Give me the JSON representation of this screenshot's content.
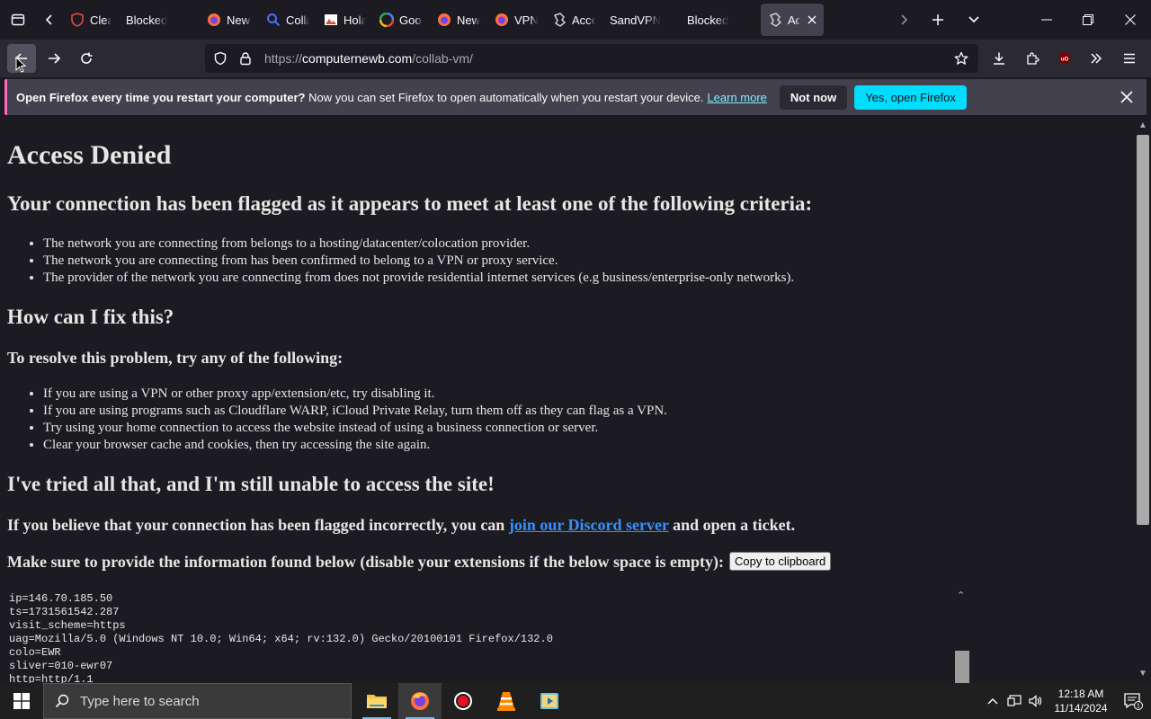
{
  "browser": {
    "tabs": [
      {
        "title": "Clear",
        "favicon": "shield-icon",
        "color": "#e34a4a"
      },
      {
        "title": "Blocked",
        "favicon": "",
        "color": ""
      },
      {
        "title": "New T",
        "favicon": "firefox-icon",
        "color": "#ff7139"
      },
      {
        "title": "Colla",
        "favicon": "search-icon",
        "color": "#4a6cff"
      },
      {
        "title": "Hola",
        "favicon": "image-icon",
        "color": "#e04d3a"
      },
      {
        "title": "Goog",
        "favicon": "google-icon",
        "color": "#4285f4"
      },
      {
        "title": "New T",
        "favicon": "firefox-icon",
        "color": "#ff7139"
      },
      {
        "title": "VPN -",
        "favicon": "firefox-icon",
        "color": "#ff7139"
      },
      {
        "title": "Acce",
        "favicon": "stamp-icon",
        "color": "#d0d0d0"
      },
      {
        "title": "SandVPN",
        "favicon": "",
        "color": ""
      },
      {
        "title": "Blocked",
        "favicon": "",
        "color": ""
      },
      {
        "title": "Ac",
        "favicon": "stamp-icon",
        "color": "#d0d0d0",
        "active": true
      }
    ],
    "url": {
      "scheme": "https://",
      "host": "computernewb.com",
      "path": "/collab-vm/"
    },
    "notification": {
      "bold": "Open Firefox every time you restart your computer?",
      "text": "Now you can set Firefox to open automatically when you restart your device.",
      "link": "Learn more",
      "not_now": "Not now",
      "yes": "Yes, open Firefox"
    }
  },
  "page": {
    "title": "Access Denied",
    "heading_flagged": "Your connection has been flagged as it appears to meet at least one of the following criteria:",
    "criteria": [
      "The network you are connecting from belongs to a hosting/datacenter/colocation provider.",
      "The network you are connecting from has been confirmed to belong to a VPN or proxy service.",
      "The provider of the network you are connecting from does not provide residential internet services (e.g business/enterprise-only networks)."
    ],
    "heading_fix": "How can I fix this?",
    "resolve_intro": "To resolve this problem, try any of the following:",
    "fixes": [
      "If you are using a VPN or other proxy app/extension/etc, try disabling it.",
      "If you are using programs such as Cloudflare WARP, iCloud Private Relay, turn them off as they can flag as a VPN.",
      "Try using your home connection to access the website instead of using a business connection or server.",
      "Clear your browser cache and cookies, then try accessing the site again."
    ],
    "heading_tried": "I've tried all that, and I'm still unable to access the site!",
    "incorrect_pre": "If you believe that your connection has been flagged incorrectly, you can",
    "discord_link": "join our Discord server",
    "incorrect_post": "and open a ticket.",
    "provide_info": "Make sure to provide the information found below (disable your extensions if the below space is empty):",
    "copy_button": "Copy to clipboard",
    "info_lines": [
      "ip=146.70.185.50",
      "ts=1731561542.287",
      "visit_scheme=https",
      "uag=Mozilla/5.0 (Windows NT 10.0; Win64; x64; rv:132.0) Gecko/20100101 Firefox/132.0",
      "colo=EWR",
      "sliver=010-ewr07",
      "http=http/1.1"
    ]
  },
  "taskbar": {
    "search_placeholder": "Type here to search",
    "time": "12:18 AM",
    "date": "11/14/2024",
    "notification_count": "1"
  }
}
